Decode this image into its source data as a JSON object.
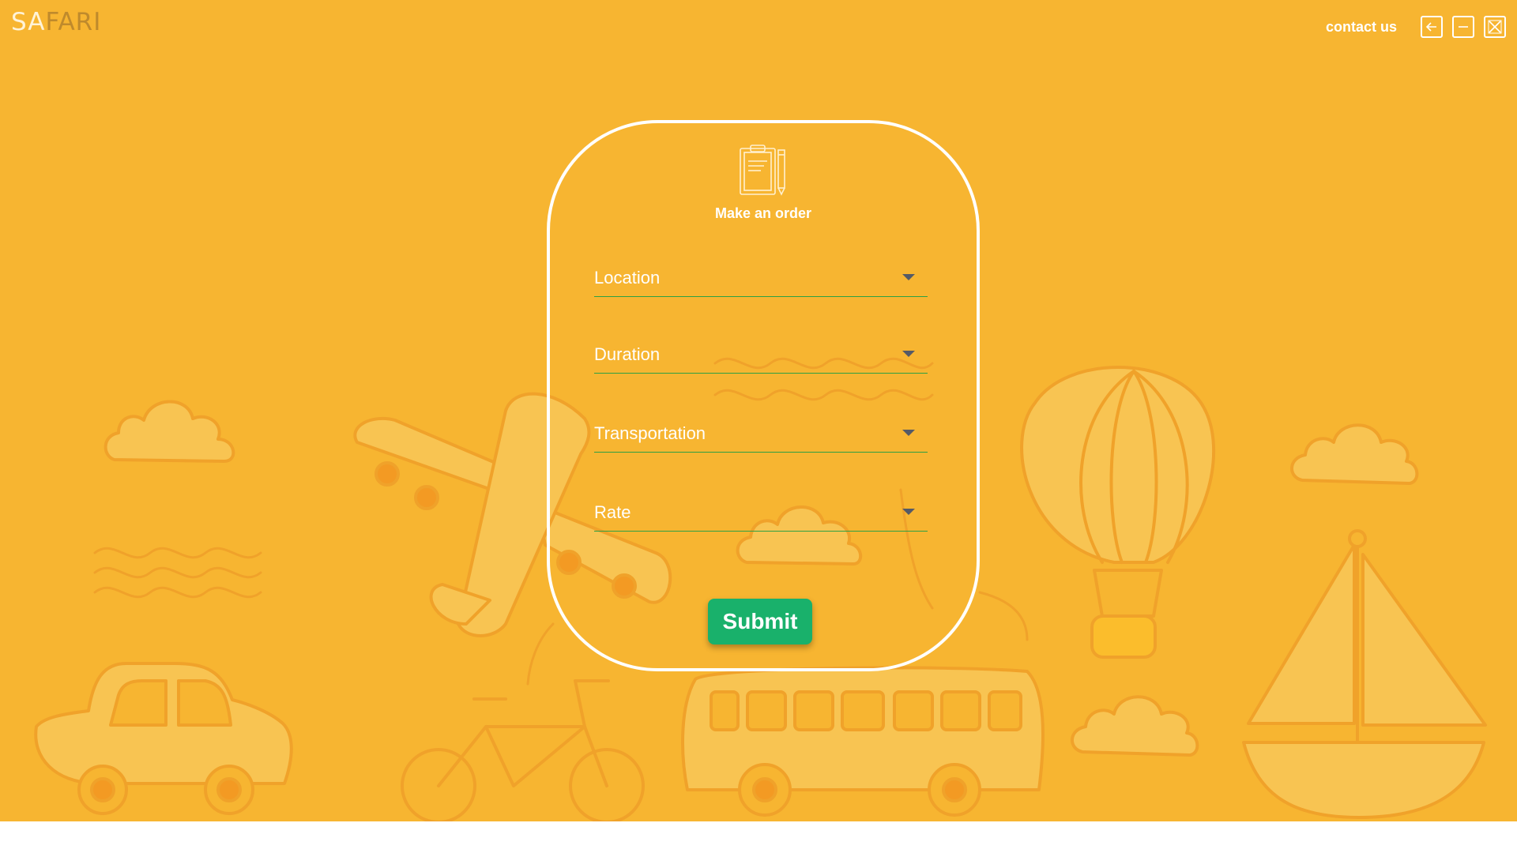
{
  "app": {
    "logo_part1": "SA",
    "logo_part2": "FARI",
    "background_color": "#f7b531"
  },
  "topbar": {
    "contact_label": "contact us",
    "buttons": [
      "back-arrow-icon",
      "minimize-icon",
      "close-icon"
    ]
  },
  "form": {
    "icon": "clipboard-pencil-icon",
    "title": "Make an order",
    "fields": [
      {
        "label": "Location"
      },
      {
        "label": "Duration"
      },
      {
        "label": "Transportation"
      },
      {
        "label": "Rate"
      }
    ],
    "submit_label": "Submit",
    "submit_color": "#19b16b",
    "underline_color": "#2ea043"
  },
  "decorations": [
    "cloud-icon",
    "airplane-icon",
    "hot-air-balloon-icon",
    "sailboat-icon",
    "car-icon",
    "bicycle-icon",
    "bus-icon",
    "wave-lines-icon"
  ]
}
